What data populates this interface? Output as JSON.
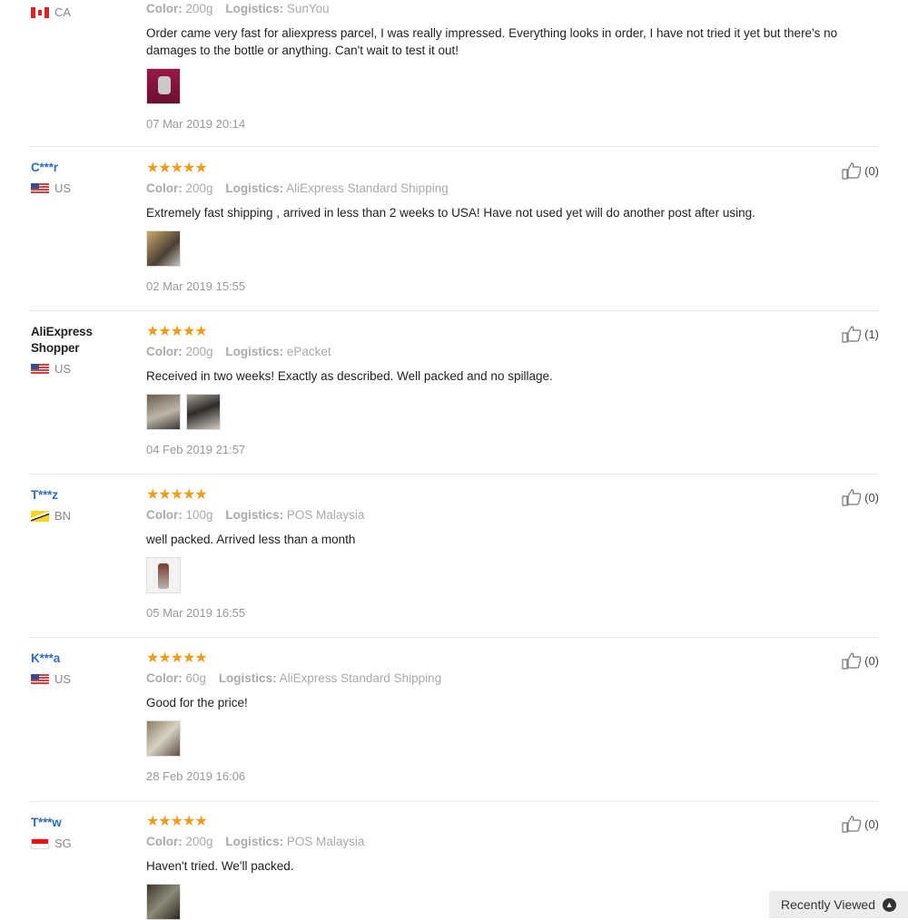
{
  "labels": {
    "color": "Color:",
    "logistics": "Logistics:"
  },
  "reviews": [
    {
      "name": "",
      "country": "CA",
      "stars": "★★★★★",
      "color": "200g",
      "logistics": "SunYou",
      "text": "Order came very fast for aliexpress parcel, I was really impressed. Everything looks in order, I have not tried it yet but there's no damages to the bottle or anything. Can't wait to test it out!",
      "date": "07 Mar 2019 20:14",
      "helpful": ""
    },
    {
      "name": "C***r",
      "country": "US",
      "stars": "★★★★★",
      "color": "200g",
      "logistics": "AliExpress Standard Shipping",
      "text": "Extremely fast shipping , arrived in less than 2 weeks to USA! Have not used yet will do another post after using.",
      "date": "02 Mar 2019 15:55",
      "helpful": "(0)"
    },
    {
      "name": "AliExpress Shopper",
      "country": "US",
      "stars": "★★★★★",
      "color": "200g",
      "logistics": "ePacket",
      "text": "Received in two weeks! Exactly as described. Well packed and no spillage.",
      "date": "04 Feb 2019 21:57",
      "helpful": "(1)"
    },
    {
      "name": "T***z",
      "country": "BN",
      "stars": "★★★★★",
      "color": "100g",
      "logistics": "POS Malaysia",
      "text": "well packed. Arrived less than a month",
      "date": "05 Mar 2019 16:55",
      "helpful": "(0)"
    },
    {
      "name": "K***a",
      "country": "US",
      "stars": "★★★★★",
      "color": "60g",
      "logistics": "AliExpress Standard Shipping",
      "text": "Good for the price!",
      "date": "28 Feb 2019 16:06",
      "helpful": "(0)"
    },
    {
      "name": "T***w",
      "country": "SG",
      "stars": "★★★★★",
      "color": "200g",
      "logistics": "POS Malaysia",
      "text": "Haven't tried. We'll packed.",
      "date": "",
      "helpful": "(0)"
    }
  ],
  "recently_viewed": "Recently Viewed",
  "icons": {
    "helpful": "thumbs-up-icon",
    "recent": "chevron-up-icon"
  }
}
